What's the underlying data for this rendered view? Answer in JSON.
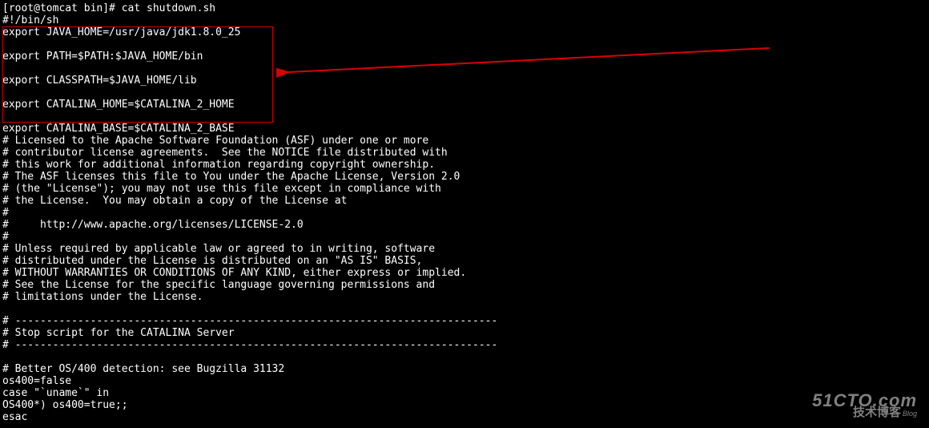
{
  "terminal": {
    "lines": [
      "[root@tomcat bin]# cat shutdown.sh",
      "#!/bin/sh",
      "export JAVA_HOME=/usr/java/jdk1.8.0_25",
      "",
      "export PATH=$PATH:$JAVA_HOME/bin",
      "",
      "export CLASSPATH=$JAVA_HOME/lib",
      "",
      "export CATALINA_HOME=$CATALINA_2_HOME",
      "",
      "export CATALINA_BASE=$CATALINA_2_BASE",
      "# Licensed to the Apache Software Foundation (ASF) under one or more",
      "# contributor license agreements.  See the NOTICE file distributed with",
      "# this work for additional information regarding copyright ownership.",
      "# The ASF licenses this file to You under the Apache License, Version 2.0",
      "# (the \"License\"); you may not use this file except in compliance with",
      "# the License.  You may obtain a copy of the License at",
      "#",
      "#     http://www.apache.org/licenses/LICENSE-2.0",
      "#",
      "# Unless required by applicable law or agreed to in writing, software",
      "# distributed under the License is distributed on an \"AS IS\" BASIS,",
      "# WITHOUT WARRANTIES OR CONDITIONS OF ANY KIND, either express or implied.",
      "# See the License for the specific language governing permissions and",
      "# limitations under the License.",
      "",
      "# -----------------------------------------------------------------------------",
      "# Stop script for the CATALINA Server",
      "# -----------------------------------------------------------------------------",
      "",
      "# Better OS/400 detection: see Bugzilla 31132",
      "os400=false",
      "case \"`uname`\" in",
      "OS400*) os400=true;;",
      "esac"
    ]
  },
  "watermark": {
    "line1": "51CTO.com",
    "line2": "技术博客",
    "blog": "Blog"
  },
  "annotation": {
    "arrow_color": "#d00",
    "box_color": "#c00"
  }
}
